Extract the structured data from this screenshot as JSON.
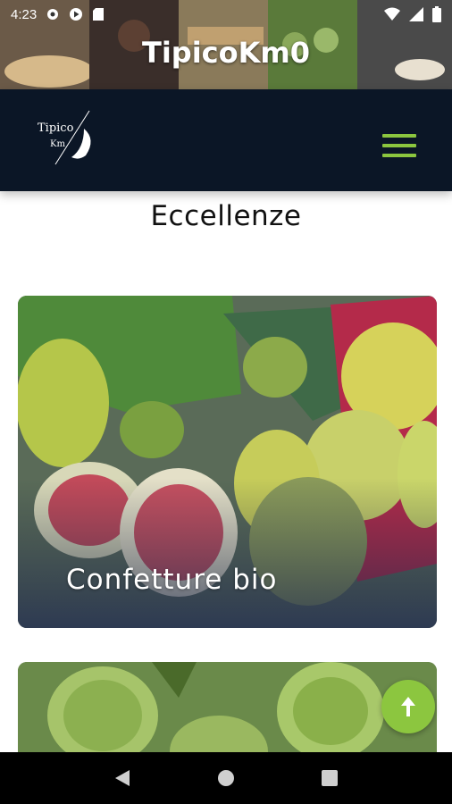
{
  "status_bar": {
    "time": "4:23",
    "left_icons": [
      "gear-icon",
      "play-icon",
      "sd-card-icon"
    ],
    "right_icons": [
      "wifi-icon",
      "signal-icon",
      "battery-icon"
    ]
  },
  "app_banner": {
    "title": "TipicoKm0"
  },
  "site_header": {
    "logo_line1": "Tipico",
    "logo_line2": "Km",
    "menu_icon": "hamburger-menu-icon"
  },
  "page": {
    "title": "Eccellenze"
  },
  "cards": [
    {
      "label": "Confetture  bio",
      "image": "figs-photo"
    },
    {
      "label": "",
      "image": "artichokes-photo"
    }
  ],
  "fab": {
    "icon": "arrow-up-icon"
  },
  "nav_bar": {
    "buttons": [
      "back-icon",
      "home-icon",
      "recents-icon"
    ]
  },
  "colors": {
    "header_bg": "#0b1626",
    "accent_green": "#8cc63f",
    "title_text": "#111111"
  }
}
